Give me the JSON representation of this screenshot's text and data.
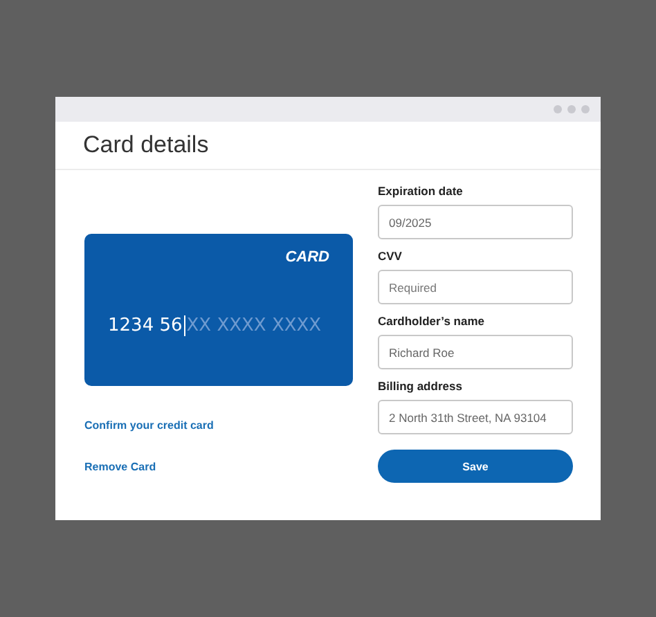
{
  "window": {
    "title": "Card details"
  },
  "card": {
    "brand": "CARD",
    "number_typed": "1234 56",
    "number_placeholder": "XX XXXX XXXX"
  },
  "links": [
    "Confirm your credit card",
    "Remove Card"
  ],
  "fields": [
    {
      "label": "Expiration date",
      "value": "09/2025"
    },
    {
      "label": "CVV",
      "placeholder": "Required"
    },
    {
      "label": "Cardholder’s name",
      "value": "Richard Roe"
    },
    {
      "label": "Billing address",
      "value": "2 North 31th Street, NA 93104"
    }
  ],
  "buttons": [
    "Save"
  ]
}
